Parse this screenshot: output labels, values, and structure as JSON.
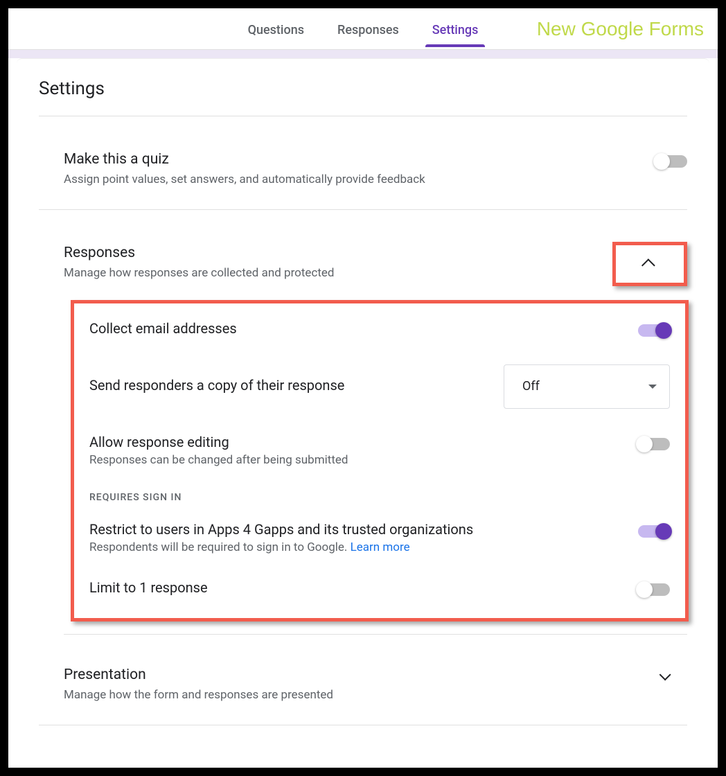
{
  "tabs": {
    "questions": "Questions",
    "responses": "Responses",
    "settings": "Settings"
  },
  "new_label": "New Google Forms",
  "page_title": "Settings",
  "quiz": {
    "title": "Make this a quiz",
    "desc": "Assign point values, set answers, and automatically provide feedback"
  },
  "responses_section": {
    "title": "Responses",
    "desc": "Manage how responses are collected and protected",
    "collect_email": "Collect email addresses",
    "send_copy": "Send responders a copy of their response",
    "send_copy_value": "Off",
    "allow_edit_title": "Allow response editing",
    "allow_edit_desc": "Responses can be changed after being submitted",
    "requires_label": "REQUIRES SIGN IN",
    "restrict_title": "Restrict to users in Apps 4 Gapps and its trusted organizations",
    "restrict_desc_pre": "Respondents will be required to sign in to Google. ",
    "restrict_link": "Learn more",
    "limit_title": "Limit to 1 response"
  },
  "presentation": {
    "title": "Presentation",
    "desc": "Manage how the form and responses are presented"
  }
}
